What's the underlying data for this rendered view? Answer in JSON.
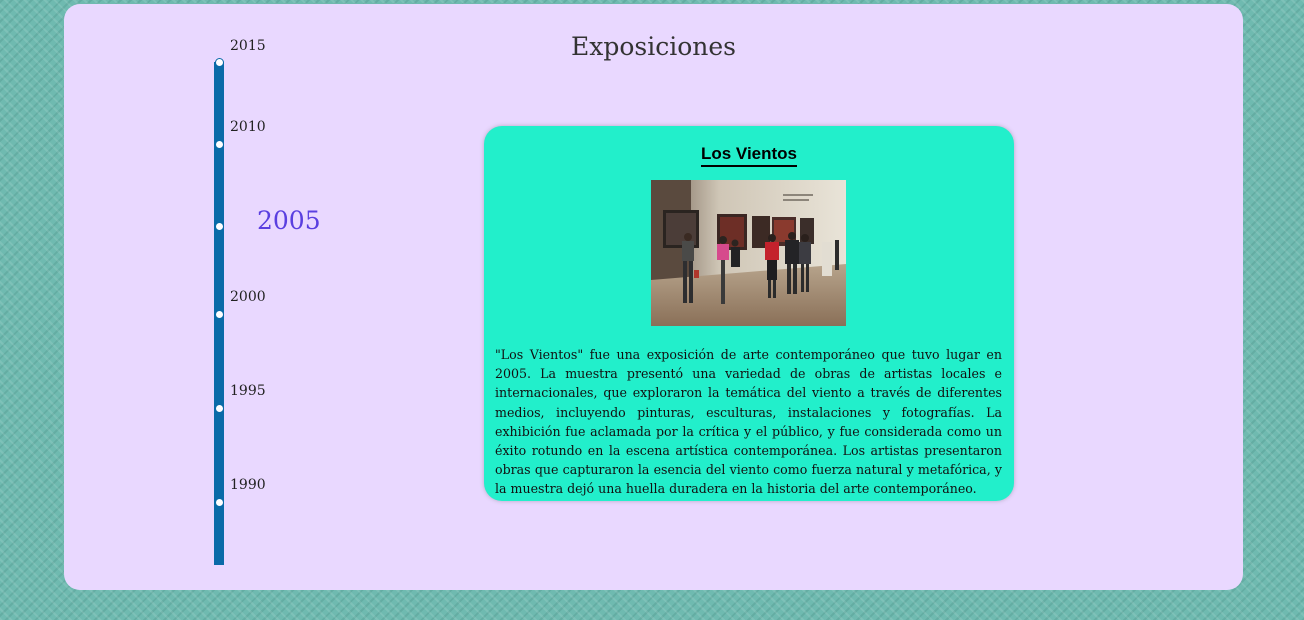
{
  "page": {
    "title": "Exposiciones"
  },
  "timeline": {
    "years": [
      {
        "label": "2015",
        "active": false
      },
      {
        "label": "2010",
        "active": false
      },
      {
        "label": "2005",
        "active": true
      },
      {
        "label": "2000",
        "active": false
      },
      {
        "label": "1995",
        "active": false
      },
      {
        "label": "1990",
        "active": false
      }
    ]
  },
  "exhibition": {
    "title": "Los Vientos",
    "photo_icon": "gallery-photo",
    "description": "\"Los Vientos\" fue una exposición de arte contemporáneo que tuvo lugar en 2005. La muestra presentó una variedad de obras de artistas locales e internacionales, que exploraron la temática del viento a través de diferentes medios, incluyendo pinturas, esculturas, instalaciones y fotografías. La exhibición fue aclamada por la crítica y el público, y fue considerada como un éxito rotundo en la escena artística contemporánea. Los artistas presentaron obras que capturaron la esencia del viento como fuerza natural y metafórica, y la muestra dejó una huella duradera en la historia del arte contemporáneo."
  },
  "colors": {
    "background": "#6fbab0",
    "panel": "#e9d8ff",
    "timeline": "#0a6aa8",
    "active_year": "#5a3fe0",
    "card": "#22efcb"
  }
}
